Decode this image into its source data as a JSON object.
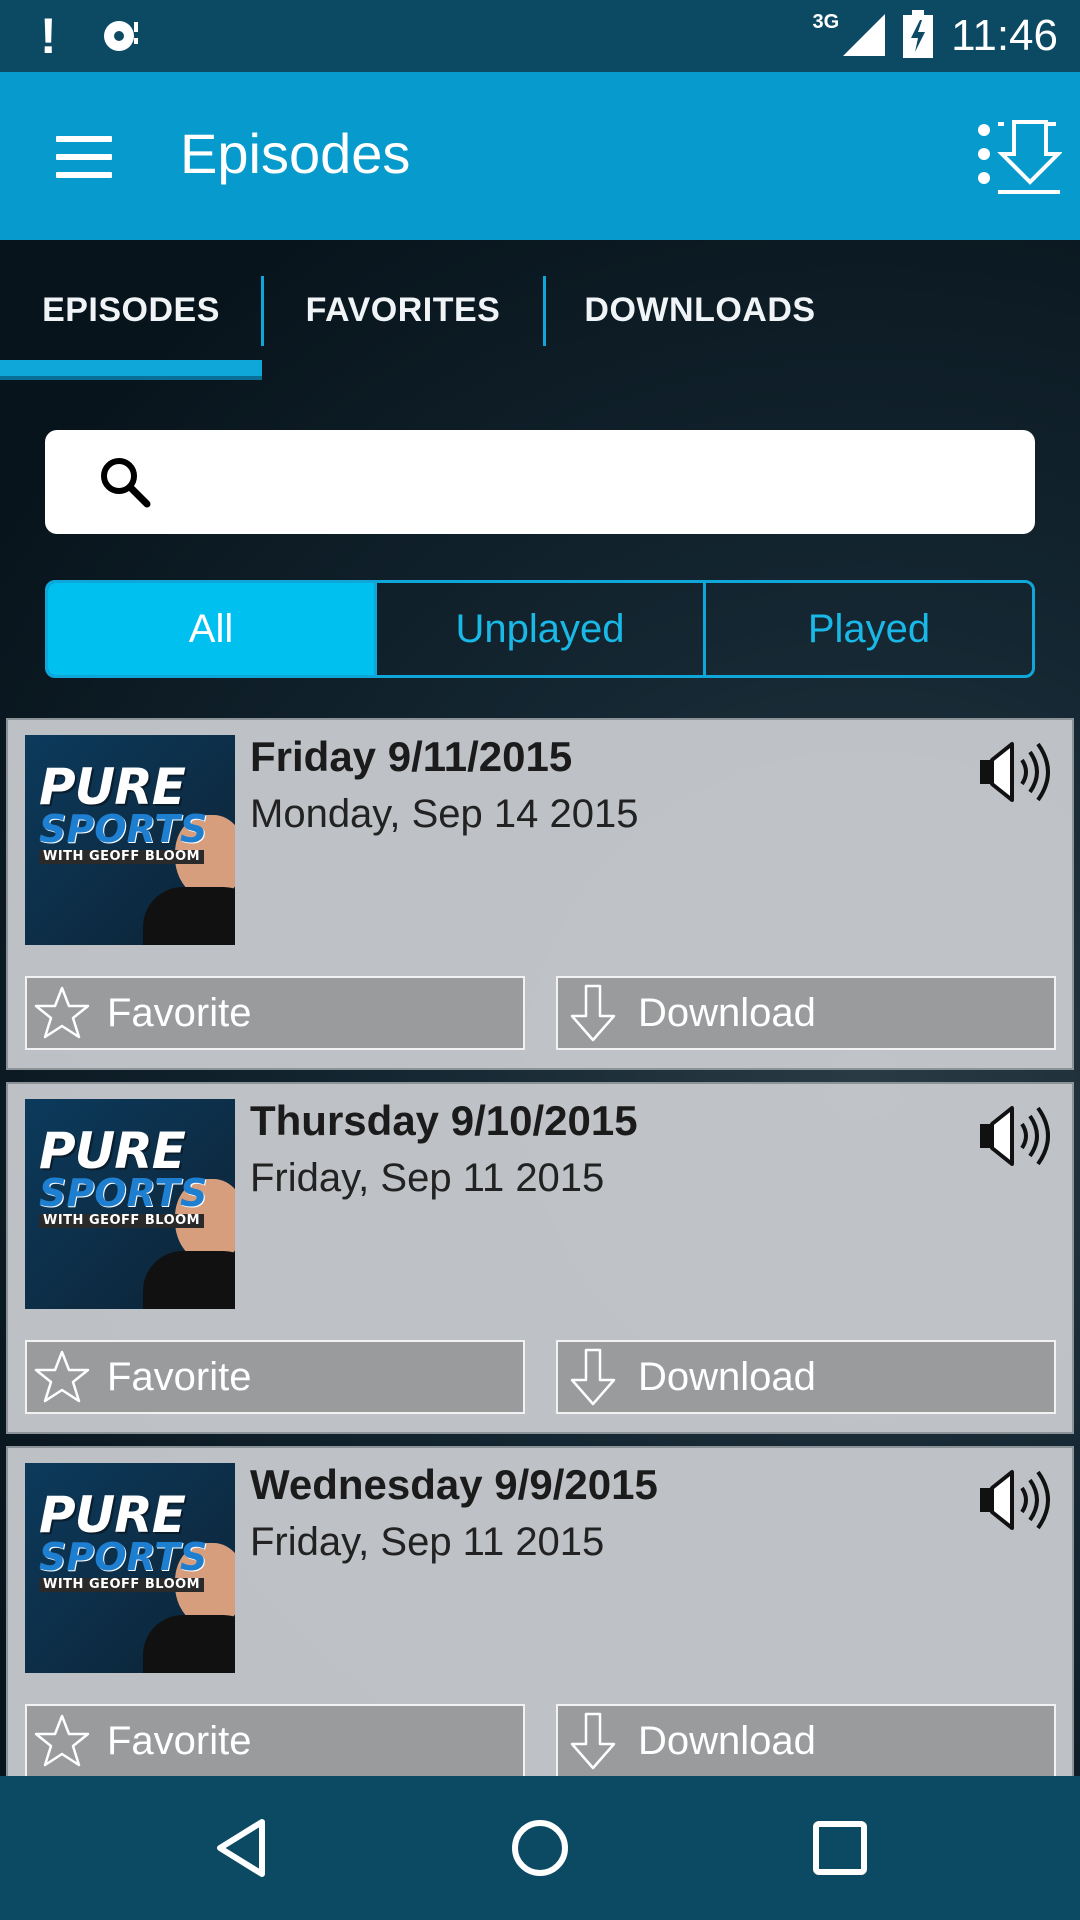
{
  "status_bar": {
    "network": "3G",
    "time": "11:46",
    "icons": [
      "alert-icon",
      "sync-disc-icon",
      "signal-icon",
      "battery-charging-icon"
    ]
  },
  "app_bar": {
    "title": "Episodes",
    "icons": [
      "menu-icon",
      "download-queue-icon"
    ]
  },
  "tabs": [
    {
      "label": "EPISODES",
      "active": true
    },
    {
      "label": "FAVORITES",
      "active": false
    },
    {
      "label": "DOWNLOADS",
      "active": false
    }
  ],
  "search": {
    "placeholder": "",
    "value": ""
  },
  "filter": [
    {
      "label": "All",
      "active": true
    },
    {
      "label": "Unplayed",
      "active": false
    },
    {
      "label": "Played",
      "active": false
    }
  ],
  "episodes": [
    {
      "title": "Friday 9/11/2015",
      "date": "Monday, Sep 14 2015",
      "logo_top": "PURE",
      "logo_mid": "SPORTS",
      "logo_bottom": "WITH GEOFF BLOOM",
      "favorite_label": "Favorite",
      "download_label": "Download"
    },
    {
      "title": "Thursday 9/10/2015",
      "date": "Friday, Sep 11 2015",
      "logo_top": "PURE",
      "logo_mid": "SPORTS",
      "logo_bottom": "WITH GEOFF BLOOM",
      "favorite_label": "Favorite",
      "download_label": "Download"
    },
    {
      "title": "Wednesday 9/9/2015",
      "date": "Friday, Sep 11 2015",
      "logo_top": "PURE",
      "logo_mid": "SPORTS",
      "logo_bottom": "WITH GEOFF BLOOM",
      "favorite_label": "Favorite",
      "download_label": "Download"
    }
  ],
  "colors": {
    "status_bar": "#0c4a64",
    "app_bar": "#069bcc",
    "accent": "#0fa7d9",
    "active_segment": "#00c0f0",
    "card_bg": "#cbced2",
    "card_button": "#999b9d"
  },
  "nav_bar": {
    "icons": [
      "back-icon",
      "home-icon",
      "recents-icon"
    ]
  }
}
